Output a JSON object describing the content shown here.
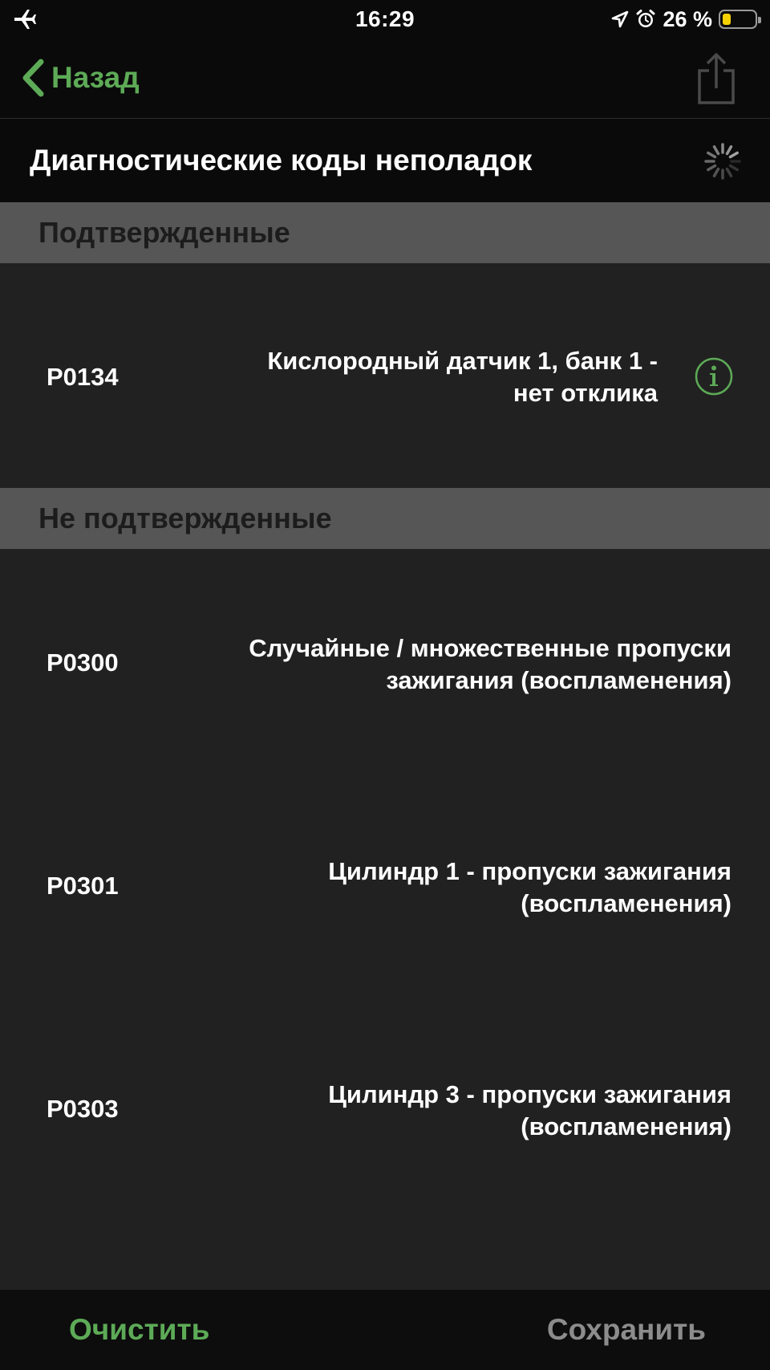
{
  "status_bar": {
    "time": "16:29",
    "battery_text": "26 %",
    "battery_level": 0.26,
    "icons": [
      "airplane-icon",
      "location-arrow-icon",
      "alarm-clock-icon",
      "battery-icon"
    ]
  },
  "nav": {
    "back_label": "Назад",
    "back_icon": "chevron-left-icon",
    "share_icon": "share-icon"
  },
  "title": {
    "text": "Диагностические коды неполадок",
    "spinner_icon": "activity-spinner-icon"
  },
  "sections": {
    "confirmed": {
      "label": "Подтвержденные",
      "rows": [
        {
          "code": "P0134",
          "desc_line1": "Кислородный датчик 1, банк 1 -",
          "desc_line2": "нет отклика",
          "info_icon": "info-icon"
        }
      ]
    },
    "unconfirmed": {
      "label": "Не подтвержденные",
      "rows": [
        {
          "code": "P0300",
          "desc_line1": "Случайные / множественные пропуски",
          "desc_line2": "зажигания (воспламенения)"
        },
        {
          "code": "P0301",
          "desc_line1": "Цилиндр 1 - пропуски зажигания",
          "desc_line2": "(воспламенения)"
        },
        {
          "code": "P0303",
          "desc_line1": "Цилиндр 3 - пропуски зажигания",
          "desc_line2": "(воспламенения)"
        }
      ]
    }
  },
  "toolbar": {
    "clear_label": "Очистить",
    "save_label": "Сохранить"
  },
  "colors": {
    "accent_green": "#5daa57",
    "section_header_bg": "#565656",
    "row_bg": "#212121",
    "bar_bg": "#0a0a0a",
    "disabled_text": "#8c8c8c",
    "battery_fill": "#f6d200"
  }
}
